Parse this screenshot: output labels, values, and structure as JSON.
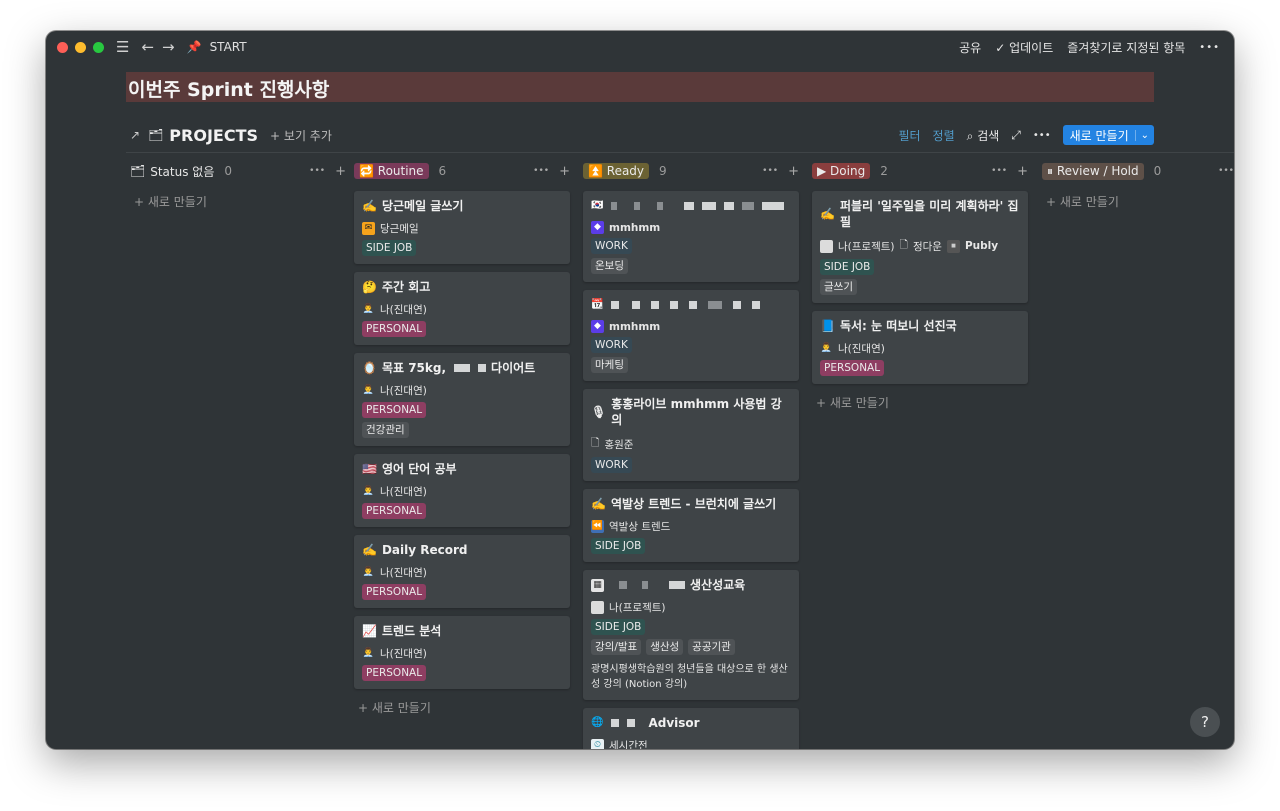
{
  "titlebar": {
    "page_title": "START",
    "share": "공유",
    "updates": "업데이트",
    "favorites": "즐겨찾기로 지정된 항목",
    "more": "•••"
  },
  "banner": {
    "title": "이번주 Sprint 진행사항"
  },
  "viewbar": {
    "title": "PROJECTS",
    "add_view": "보기 추가",
    "filter": "필터",
    "sort": "정렬",
    "search": "검색",
    "new_button": "새로 만들기"
  },
  "columns": [
    {
      "name": "Status 없음",
      "count": "0",
      "new_label": "새로 만들기"
    },
    {
      "name": "Routine",
      "count": "6",
      "color": "#7a3a5a",
      "new_label": "새로 만들기",
      "cards": [
        {
          "emoji": "✍️",
          "title": "당근메일 글쓰기",
          "person": "당근메일",
          "tags": [
            "SIDE JOB"
          ]
        },
        {
          "emoji": "🤔",
          "title": "주간 회고",
          "person": "나(진대연)",
          "tags": [
            "PERSONAL"
          ]
        },
        {
          "emoji": "🪞",
          "title": "목표 75kg,",
          "title_tail": "다이어트",
          "person": "나(진대연)",
          "tags": [
            "PERSONAL"
          ],
          "tags2": [
            "건강관리"
          ]
        },
        {
          "emoji": "🇺🇸",
          "title": "영어 단어 공부",
          "person": "나(진대연)",
          "tags": [
            "PERSONAL"
          ]
        },
        {
          "emoji": "✍️",
          "title": "Daily Record",
          "person": "나(진대연)",
          "tags": [
            "PERSONAL"
          ]
        },
        {
          "emoji": "📈",
          "title": "트렌드 분석",
          "person": "나(진대연)",
          "tags": [
            "PERSONAL"
          ]
        }
      ]
    },
    {
      "name": "Ready",
      "count": "9",
      "color": "#6b6233",
      "cards": [
        {
          "person": "mmhmm",
          "tags": [
            "WORK"
          ],
          "tags2": [
            "온보딩"
          ]
        },
        {
          "person": "mmhmm",
          "tags": [
            "WORK"
          ],
          "tags2": [
            "마케팅"
          ]
        },
        {
          "emoji": "🎙",
          "title": "홍홍라이브 mmhmm 사용법 강의",
          "person": "홍원준",
          "tags": [
            "WORK"
          ]
        },
        {
          "emoji": "✍️",
          "title": "역발상 트렌드 - 브런치에 글쓰기",
          "person": "역발상 트렌드",
          "tags": [
            "SIDE JOB"
          ]
        },
        {
          "title": "생산성교육",
          "person": "나(프로젝트)",
          "tags": [
            "SIDE JOB"
          ],
          "tags2": [
            "강의/발표",
            "생산성",
            "공공기관"
          ],
          "desc": "광명시평생학습원의 청년들을 대상으로 한 생산성 강의 (Notion 강의)"
        },
        {
          "title": "Advisor",
          "person": "세시간전"
        }
      ]
    },
    {
      "name": "Doing",
      "count": "2",
      "color": "#8a3e3e",
      "new_label": "새로 만들기",
      "cards": [
        {
          "emoji": "✍️",
          "title": "퍼블리 '일주일을 미리 계획하라' 집필",
          "person": "나(프로젝트)",
          "person2": "정다운",
          "person3": "Publy",
          "tags": [
            "SIDE JOB"
          ],
          "tags2": [
            "글쓰기"
          ]
        },
        {
          "emoji": "📘",
          "title": "독서: 눈 떠보니 선진국",
          "person": "나(진대연)",
          "tags": [
            "PERSONAL"
          ]
        }
      ]
    },
    {
      "name": "Review / Hold",
      "count": "0",
      "color": "#5e5048",
      "new_label": "새로 만들기"
    }
  ],
  "help": "?"
}
